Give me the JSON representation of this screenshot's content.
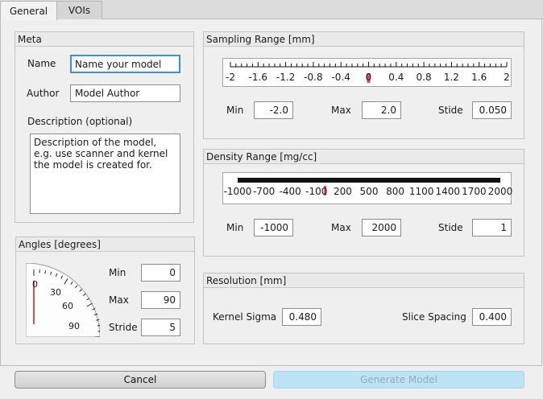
{
  "tabs": [
    "General",
    "VOIs"
  ],
  "meta": {
    "title": "Meta",
    "name_label": "Name",
    "name_value": "Name your model",
    "author_label": "Author",
    "author_value": "Model Author",
    "desc_label": "Description (optional)",
    "desc_value": "Description of the model, e.g. use scanner and kernel the model is created for."
  },
  "angles": {
    "title": "Angles [degrees]",
    "min_label": "Min",
    "min_value": "0",
    "max_label": "Max",
    "max_value": "90",
    "stride_label": "Stride",
    "stride_value": "5",
    "gauge_labels": [
      "0",
      "30",
      "60",
      "90"
    ],
    "needle_value": 0
  },
  "sampling": {
    "title": "Sampling Range [mm]",
    "ticks": [
      "-2",
      "-1.6",
      "-1.2",
      "-0.8",
      "-0.4",
      "0",
      "0.4",
      "0.8",
      "1.2",
      "1.6",
      "2"
    ],
    "range": [
      -2,
      2
    ],
    "marker_value": 0,
    "min_label": "Min",
    "min_value": "-2.0",
    "max_label": "Max",
    "max_value": "2.0",
    "stride_label": "Stide",
    "stride_value": "0.050"
  },
  "density": {
    "title": "Density Range [mg/cc]",
    "ticks": [
      "-1000",
      "-700",
      "-400",
      "-100",
      "200",
      "500",
      "800",
      "1100",
      "1400",
      "1700",
      "2000"
    ],
    "range": [
      -1000,
      2000
    ],
    "marker_value": 0,
    "min_label": "Min",
    "min_value": "-1000",
    "max_label": "Max",
    "max_value": "2000",
    "stride_label": "Stide",
    "stride_value": "1"
  },
  "resolution": {
    "title": "Resolution [mm]",
    "kernel_label": "Kernel Sigma",
    "kernel_value": "0.480",
    "slice_label": "Slice Spacing",
    "slice_value": "0.400"
  },
  "buttons": {
    "cancel": "Cancel",
    "generate": "Generate Model"
  },
  "colors": {
    "marker": "#d9534f",
    "focus": "#3b8fd6",
    "generate_bg": "#bde3f6"
  }
}
